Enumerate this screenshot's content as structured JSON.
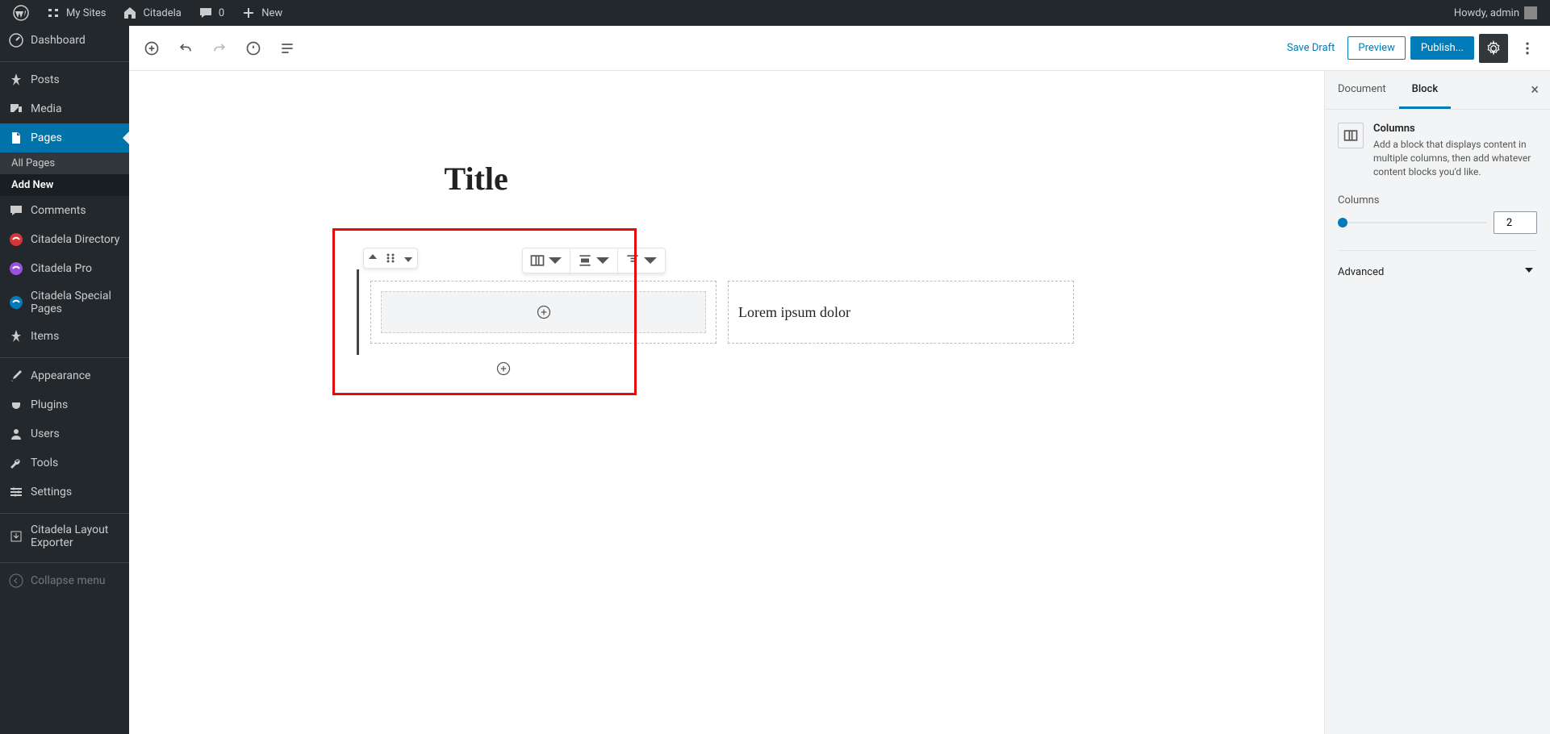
{
  "adminBar": {
    "mySites": "My Sites",
    "siteName": "Citadela",
    "comments": "0",
    "new": "New",
    "greeting": "Howdy, admin"
  },
  "adminMenu": {
    "dashboard": "Dashboard",
    "posts": "Posts",
    "media": "Media",
    "pages": "Pages",
    "allPages": "All Pages",
    "addNew": "Add New",
    "comments": "Comments",
    "citadelaDirectory": "Citadela Directory",
    "citadelaPro": "Citadela Pro",
    "citadelaSpecial": "Citadela Special Pages",
    "items": "Items",
    "appearance": "Appearance",
    "plugins": "Plugins",
    "users": "Users",
    "tools": "Tools",
    "settings": "Settings",
    "citadelaExporter": "Citadela Layout Exporter",
    "collapse": "Collapse menu"
  },
  "editor": {
    "saveDraft": "Save Draft",
    "preview": "Preview",
    "publish": "Publish...",
    "title": "Title",
    "columnText": "Lorem ipsum dolor"
  },
  "inspector": {
    "documentTab": "Document",
    "blockTab": "Block",
    "blockTitle": "Columns",
    "blockDesc": "Add a block that displays content in multiple columns, then add whatever content blocks you'd like.",
    "columnsLabel": "Columns",
    "columnsValue": "2",
    "advanced": "Advanced"
  }
}
